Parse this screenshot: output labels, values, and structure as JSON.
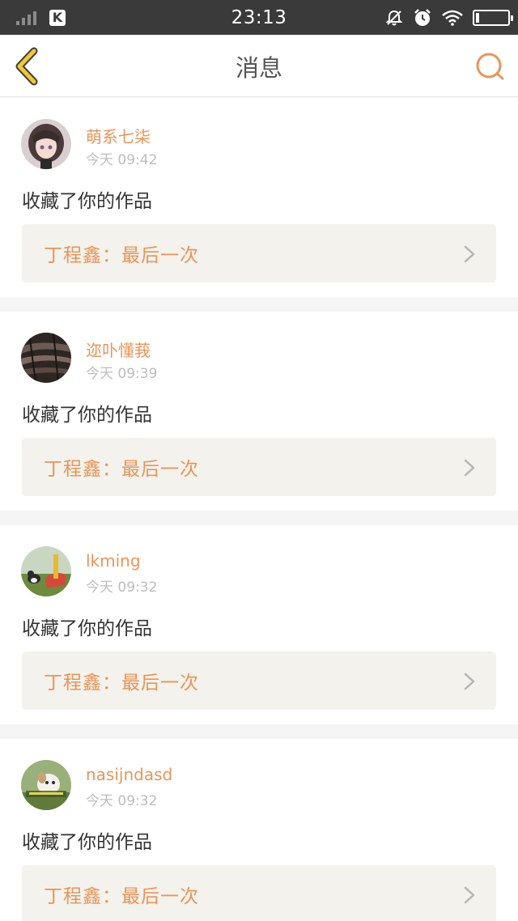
{
  "status_bar": {
    "time": "23:13",
    "app_icon_letter": "K"
  },
  "header": {
    "title": "消息",
    "accent_color": "#e8955a",
    "back_icon_color": "#f2c832"
  },
  "messages": [
    {
      "username": "萌系七柒",
      "time": "今天 09:42",
      "action": "收藏了你的作品",
      "work_title": "丁程鑫：最后一次",
      "avatar": "anime-girl-avatar"
    },
    {
      "username": "迩卟懂莪",
      "time": "今天 09:39",
      "action": "收藏了你的作品",
      "work_title": "丁程鑫：最后一次",
      "avatar": "dark-texture-avatar"
    },
    {
      "username": "lkming",
      "time": "今天 09:32",
      "action": "收藏了你的作品",
      "work_title": "丁程鑫：最后一次",
      "avatar": "dog-playground-avatar"
    },
    {
      "username": "nasijndasd",
      "time": "今天 09:32",
      "action": "收藏了你的作品",
      "work_title": "丁程鑫：最后一次",
      "avatar": "puppy-avatar"
    }
  ]
}
